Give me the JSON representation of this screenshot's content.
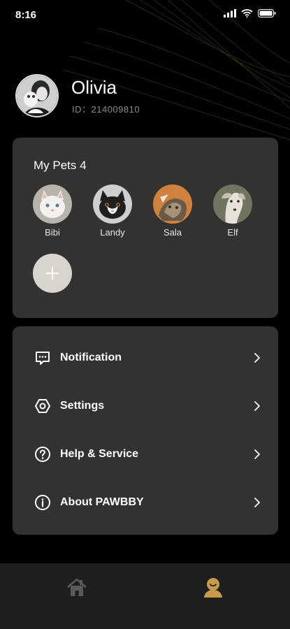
{
  "status_bar": {
    "time": "8:16"
  },
  "profile": {
    "name": "Olivia",
    "id_label": "ID：214009810"
  },
  "pets": {
    "title": "My Pets 4",
    "items": [
      {
        "name": "Bibi"
      },
      {
        "name": "Landy"
      },
      {
        "name": "Sala"
      },
      {
        "name": "Elf"
      }
    ]
  },
  "menu": [
    {
      "label": "Notification",
      "icon": "message-icon"
    },
    {
      "label": "Settings",
      "icon": "gear-icon"
    },
    {
      "label": "Help & Service",
      "icon": "help-icon"
    },
    {
      "label": "About PAWBBY",
      "icon": "info-icon"
    }
  ],
  "bottom_nav": {
    "items": [
      "home-icon",
      "profile-icon"
    ],
    "active": "profile-icon"
  },
  "colors": {
    "accent": "#c79a4e",
    "card": "#333231",
    "background": "#000000"
  }
}
